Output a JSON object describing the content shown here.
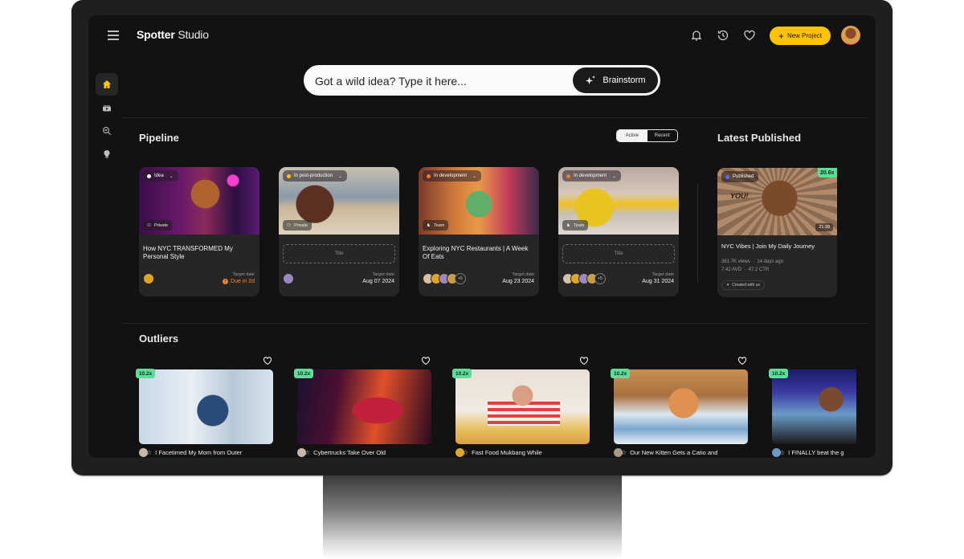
{
  "app": {
    "brand_bold": "Spotter",
    "brand_light": "Studio"
  },
  "topbar": {
    "icons": [
      "bell-icon",
      "history-icon",
      "heart-icon"
    ],
    "new_project_label": "New Project"
  },
  "sidebar": {
    "items": [
      {
        "name": "home",
        "icon": "home-icon",
        "active": true
      },
      {
        "name": "videos",
        "icon": "video-folder-icon",
        "active": false
      },
      {
        "name": "research",
        "icon": "search-analytics-icon",
        "active": false
      },
      {
        "name": "ideas",
        "icon": "lightbulb-icon",
        "active": false
      }
    ]
  },
  "idea_bar": {
    "placeholder": "Got a wild idea? Type it here...",
    "value": "",
    "button_label": "Brainstorm"
  },
  "pipeline": {
    "title": "Pipeline",
    "toggle": {
      "options": [
        "Active",
        "Recent"
      ],
      "selected": "Active"
    },
    "cards": [
      {
        "status": "Idea",
        "status_color": "#ffffff",
        "visibility": "Private",
        "title": "How NYC TRANSFORMED My Personal Style",
        "title_placeholder": "",
        "target_label": "Target date",
        "target_value": "Due in 2d",
        "overdue": true,
        "collaborators_extra": ""
      },
      {
        "status": "In post-production",
        "status_color": "#ffc400",
        "visibility": "Private",
        "title": "",
        "title_placeholder": "Title",
        "target_label": "Target date",
        "target_value": "Aug 07 2024",
        "overdue": false,
        "collaborators_extra": ""
      },
      {
        "status": "In development",
        "status_color": "#f07a2b",
        "visibility": "Team",
        "title": "Exploring NYC Restaurants | A Week Of Eats",
        "title_placeholder": "",
        "target_label": "Target date",
        "target_value": "Aug 23 2024",
        "overdue": false,
        "collaborators_extra": "+5"
      },
      {
        "status": "In development",
        "status_color": "#f07a2b",
        "visibility": "Team",
        "title": "",
        "title_placeholder": "Title",
        "target_label": "Target date",
        "target_value": "Aug 31 2024",
        "overdue": false,
        "collaborators_extra": "+5"
      }
    ]
  },
  "latest_published": {
    "title": "Latest Published",
    "card": {
      "status": "Published",
      "status_color": "#5a6cf0",
      "multiplier": "20.6x",
      "duration": "21:38",
      "thumb_text": "YOU!",
      "title": "NYC Vibes | Join My Daily Journey",
      "views": "361.7K views",
      "age": "14 days ago",
      "avd": "7:42 AVD",
      "ctr": "47.2 CTR",
      "created_label": "Created with us"
    }
  },
  "outliers": {
    "title": "Outliers",
    "items": [
      {
        "multiplier": "10.2x",
        "title": "I Facetimed My Mom from Outer"
      },
      {
        "multiplier": "10.2x",
        "title": "Cybertrucks Take Over Old"
      },
      {
        "multiplier": "10.2x",
        "title": "Fast Food Mukbang While"
      },
      {
        "multiplier": "10.2x",
        "title": "Our New Kitten Gets a Catio and"
      },
      {
        "multiplier": "10.2x",
        "title": "I FINALLY beat the g"
      }
    ]
  },
  "colors": {
    "accent": "#ffc400",
    "outlier_badge": "#5ddc9a",
    "background": "#121212",
    "card": "#262626",
    "overdue": "#f0892b"
  }
}
